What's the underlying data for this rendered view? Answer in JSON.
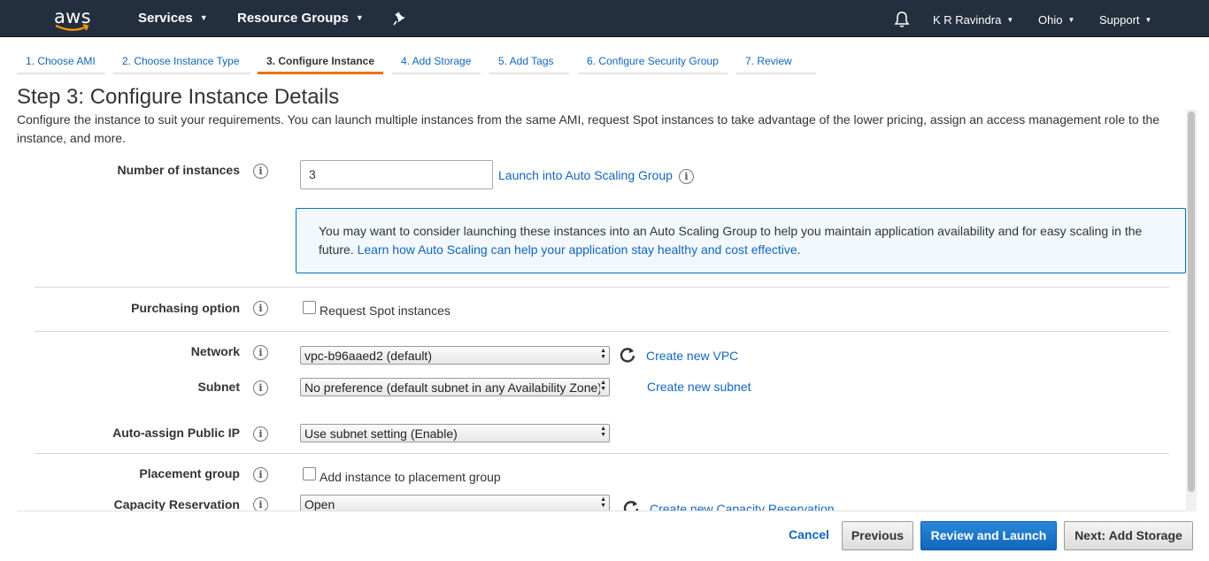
{
  "nav": {
    "logo_text": "aws",
    "services": "Services",
    "resource_groups": "Resource Groups",
    "user": "K R Ravindra",
    "region": "Ohio",
    "support": "Support"
  },
  "tabs": [
    {
      "label": "1. Choose AMI"
    },
    {
      "label": "2. Choose Instance Type"
    },
    {
      "label": "3. Configure Instance"
    },
    {
      "label": "4. Add Storage"
    },
    {
      "label": "5. Add Tags"
    },
    {
      "label": "6. Configure Security Group"
    },
    {
      "label": "7. Review"
    }
  ],
  "page": {
    "heading": "Step 3: Configure Instance Details",
    "description": "Configure the instance to suit your requirements. You can launch multiple instances from the same AMI, request Spot instances to take advantage of the lower pricing, assign an access management role to the instance, and more."
  },
  "form": {
    "num_instances_label": "Number of instances",
    "num_instances_value": "3",
    "asg_link": "Launch into Auto Scaling Group",
    "infobox_text": "You may want to consider launching these instances into an Auto Scaling Group to help you maintain application availability and for easy scaling in the future.",
    "infobox_link": "Learn how Auto Scaling can help your application stay healthy and cost effective",
    "infobox_end": ".",
    "purchasing_label": "Purchasing option",
    "spot_checkbox": "Request Spot instances",
    "network_label": "Network",
    "network_value": "vpc-b96aaed2 (default)",
    "create_vpc": "Create new VPC",
    "subnet_label": "Subnet",
    "subnet_value": "No preference (default subnet in any Availability Zone)",
    "create_subnet": "Create new subnet",
    "public_ip_label": "Auto-assign Public IP",
    "public_ip_value": "Use subnet setting (Enable)",
    "placement_label": "Placement group",
    "placement_checkbox": "Add instance to placement group",
    "capacity_label": "Capacity Reservation",
    "capacity_value": "Open",
    "create_capacity": "Create new Capacity Reservation"
  },
  "footer": {
    "cancel": "Cancel",
    "previous": "Previous",
    "review_launch": "Review and Launch",
    "next": "Next: Add Storage"
  },
  "colors": {
    "nav_bg": "#232f3e",
    "link": "#1166bb",
    "accent_orange": "#ec7211",
    "primary_button": "#1166bb",
    "infobox_bg": "#f2f8fd"
  }
}
